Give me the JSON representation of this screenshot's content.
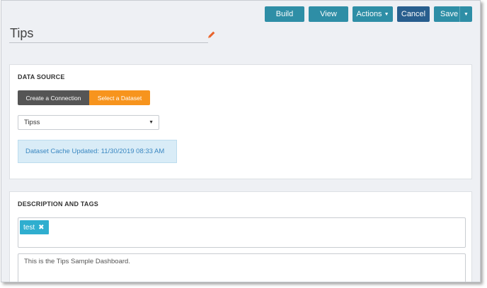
{
  "toolbar": {
    "build_label": "Build",
    "view_label": "View",
    "actions_label": "Actions",
    "cancel_label": "Cancel",
    "save_label": "Save"
  },
  "header": {
    "title": "Tips"
  },
  "data_source": {
    "heading": "DATA SOURCE",
    "segments": {
      "create_connection": "Create a Connection",
      "select_dataset": "Select a Dataset"
    },
    "selected_dataset": "Tipss",
    "cache_note": "Dataset Cache Updated: 11/30/2019 08:33 AM"
  },
  "description_tags": {
    "heading": "DESCRIPTION AND TAGS",
    "tags": [
      {
        "label": "test"
      }
    ],
    "description": "This is the Tips Sample Dashboard."
  },
  "colors": {
    "primary_button": "#2e8ea6",
    "cancel_button": "#285e8e",
    "segment_active": "#f7941d",
    "segment_inactive": "#555555",
    "tag": "#2faecf",
    "info_bg": "#d9ecf7",
    "edit_icon": "#e8632b"
  }
}
